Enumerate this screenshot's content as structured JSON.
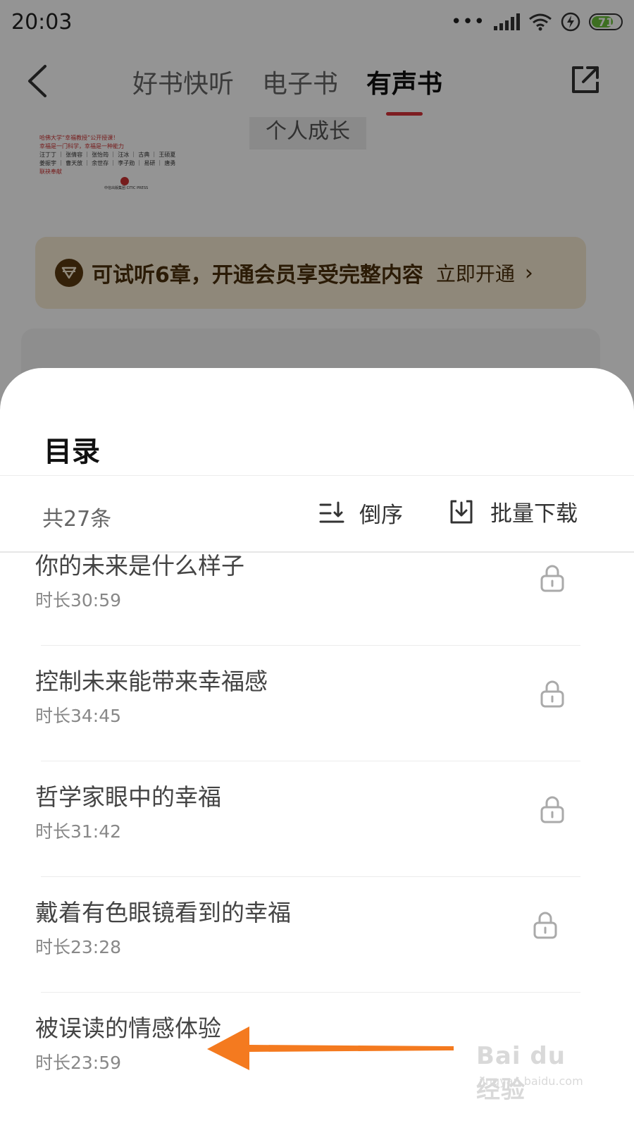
{
  "status_bar": {
    "time": "20:03",
    "battery": "71"
  },
  "nav": {
    "tabs": [
      {
        "label": "好书快听",
        "active": false
      },
      {
        "label": "电子书",
        "active": false
      },
      {
        "label": "有声书",
        "active": true
      }
    ]
  },
  "category_chip": "个人成长",
  "book_cover": {
    "lines": [
      "哈佛大学“幸福教授”公开授课！",
      "幸福是一门科学，幸福是一种能力",
      "汪丁丁 ｜ 张倩容 ｜ 张怡筠 ｜ 汪冰 ｜ 古典 ｜ 王硕夏",
      "姜振宇 ｜ 曹天放 ｜ 余世存 ｜ 李子勋 ｜ 易研 ｜ 唐勇",
      "联袂奉献",
      "中信出版集团 CITIC PRESS"
    ]
  },
  "vip_banner": {
    "text": "可试听6章，开通会员享受完整内容",
    "link": "立即开通"
  },
  "catalog": {
    "title": "目录",
    "count": "共27条",
    "sort_label": "倒序",
    "download_label": "批量下载",
    "chapters": [
      {
        "title": "你的未来是什么样子",
        "duration": "时长30:59"
      },
      {
        "title": "控制未来能带来幸福感",
        "duration": "时长34:45"
      },
      {
        "title": "哲学家眼中的幸福",
        "duration": "时长31:42"
      },
      {
        "title": "戴着有色眼镜看到的幸福",
        "duration": "时长23:28"
      },
      {
        "title": "被误读的情感体验",
        "duration": "时长23:59"
      }
    ]
  },
  "watermark": {
    "text": "Bai du 经验",
    "sub": "jingyan.baidu.com"
  },
  "colors": {
    "accent": "#d8333a",
    "vip_bg": "#f6ead3",
    "vip_text": "#4a2f0c",
    "arrow": "#f47a1f"
  }
}
